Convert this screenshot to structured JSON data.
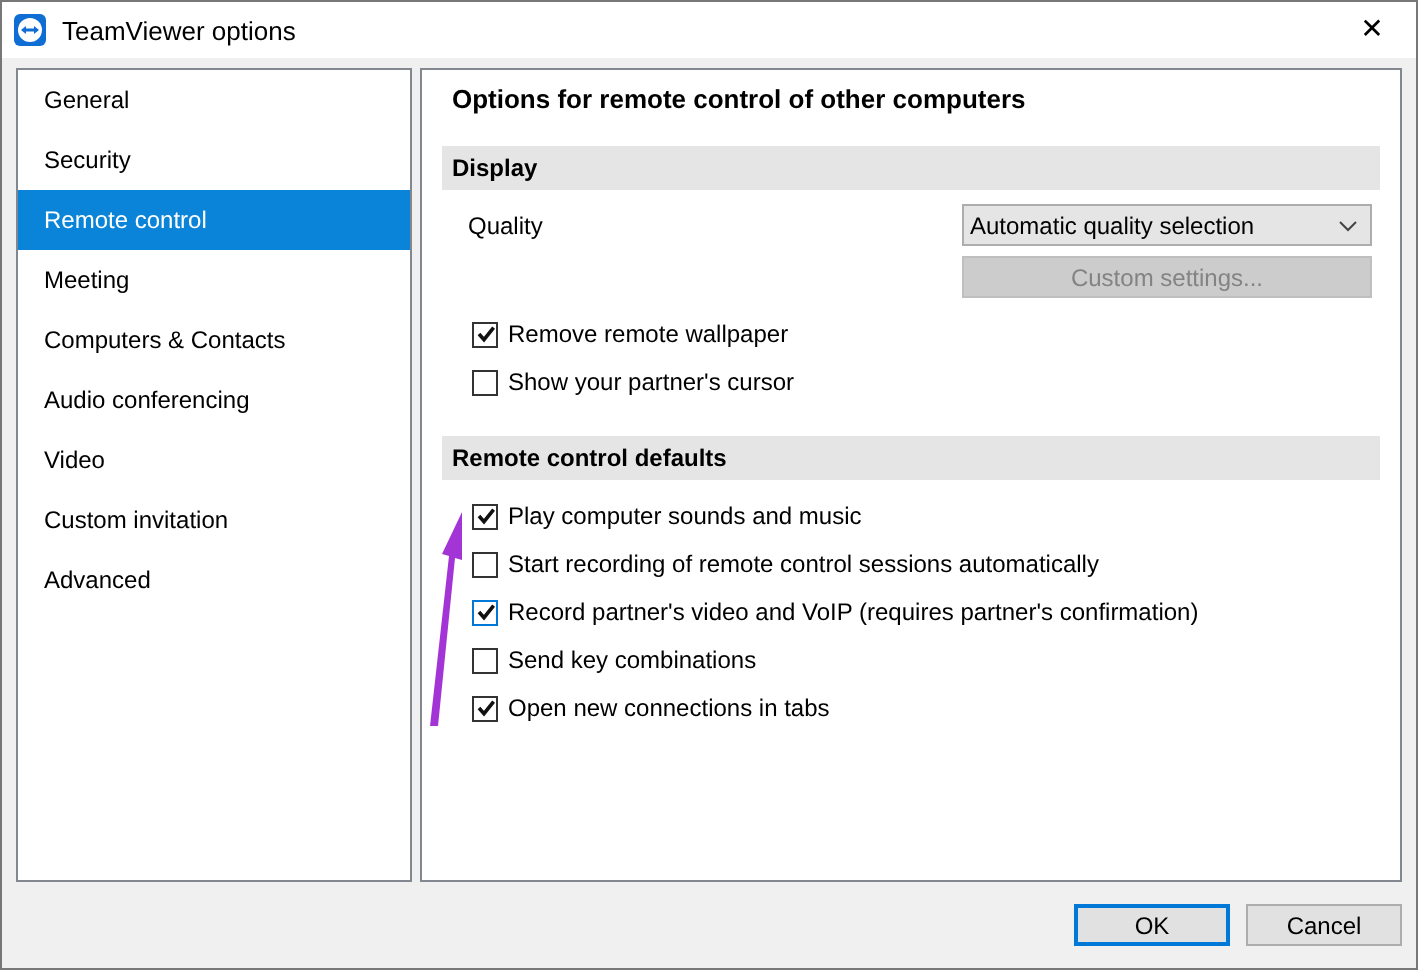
{
  "window": {
    "title": "TeamViewer options",
    "close": "✕"
  },
  "sidebar": {
    "items": [
      {
        "label": "General",
        "selected": false
      },
      {
        "label": "Security",
        "selected": false
      },
      {
        "label": "Remote control",
        "selected": true
      },
      {
        "label": "Meeting",
        "selected": false
      },
      {
        "label": "Computers & Contacts",
        "selected": false
      },
      {
        "label": "Audio conferencing",
        "selected": false
      },
      {
        "label": "Video",
        "selected": false
      },
      {
        "label": "Custom invitation",
        "selected": false
      },
      {
        "label": "Advanced",
        "selected": false
      }
    ]
  },
  "panel": {
    "title": "Options for remote control of other computers",
    "sections": [
      {
        "header": "Display",
        "quality": {
          "label": "Quality",
          "value": "Automatic quality selection",
          "button": "Custom settings...",
          "button_disabled": true
        },
        "checkboxes": [
          {
            "label": "Remove remote wallpaper",
            "checked": true,
            "focused": false
          },
          {
            "label": "Show your partner's cursor",
            "checked": false,
            "focused": false
          }
        ]
      },
      {
        "header": "Remote control defaults",
        "checkboxes": [
          {
            "label": "Play computer sounds and music",
            "checked": true,
            "focused": false
          },
          {
            "label": "Start recording of remote control sessions automatically",
            "checked": false,
            "focused": false
          },
          {
            "label": "Record partner's video and VoIP (requires partner's confirmation)",
            "checked": true,
            "focused": true
          },
          {
            "label": "Send key combinations",
            "checked": false,
            "focused": false
          },
          {
            "label": "Open new connections in tabs",
            "checked": true,
            "focused": false
          }
        ]
      }
    ]
  },
  "buttons": [
    {
      "label": "OK",
      "default": true
    },
    {
      "label": "Cancel",
      "default": false
    }
  ]
}
